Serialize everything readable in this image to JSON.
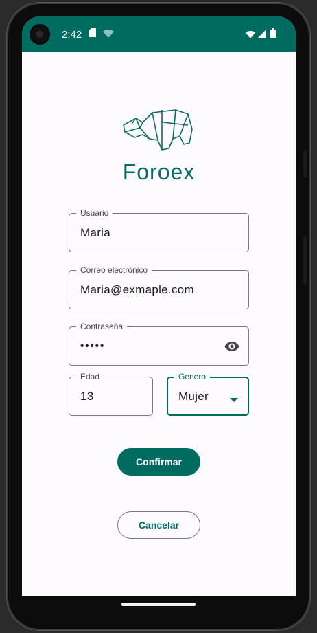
{
  "status_bar": {
    "time": "2:42",
    "icons": [
      "sd-card-icon",
      "wifi-signal-icon",
      "cellular-signal-icon",
      "battery-icon"
    ],
    "color": "#006b61"
  },
  "app": {
    "name": "Foroex",
    "logo": "rhino-origami-logo",
    "accent_color": "#006b61"
  },
  "form": {
    "usuario": {
      "label": "Usuario",
      "value": "Maria"
    },
    "correo": {
      "label": "Correo electrónico",
      "value": "Maria@exmaple.com"
    },
    "contrasena": {
      "label": "Contraseña",
      "value": "•••••",
      "toggle_icon": "eye-icon"
    },
    "edad": {
      "label": "Edad",
      "value": "13"
    },
    "genero": {
      "label": "Genero",
      "value": "Mujer",
      "dropdown_icon": "dropdown-arrow-icon"
    }
  },
  "buttons": {
    "confirmar": "Confirmar",
    "cancelar": "Cancelar"
  }
}
